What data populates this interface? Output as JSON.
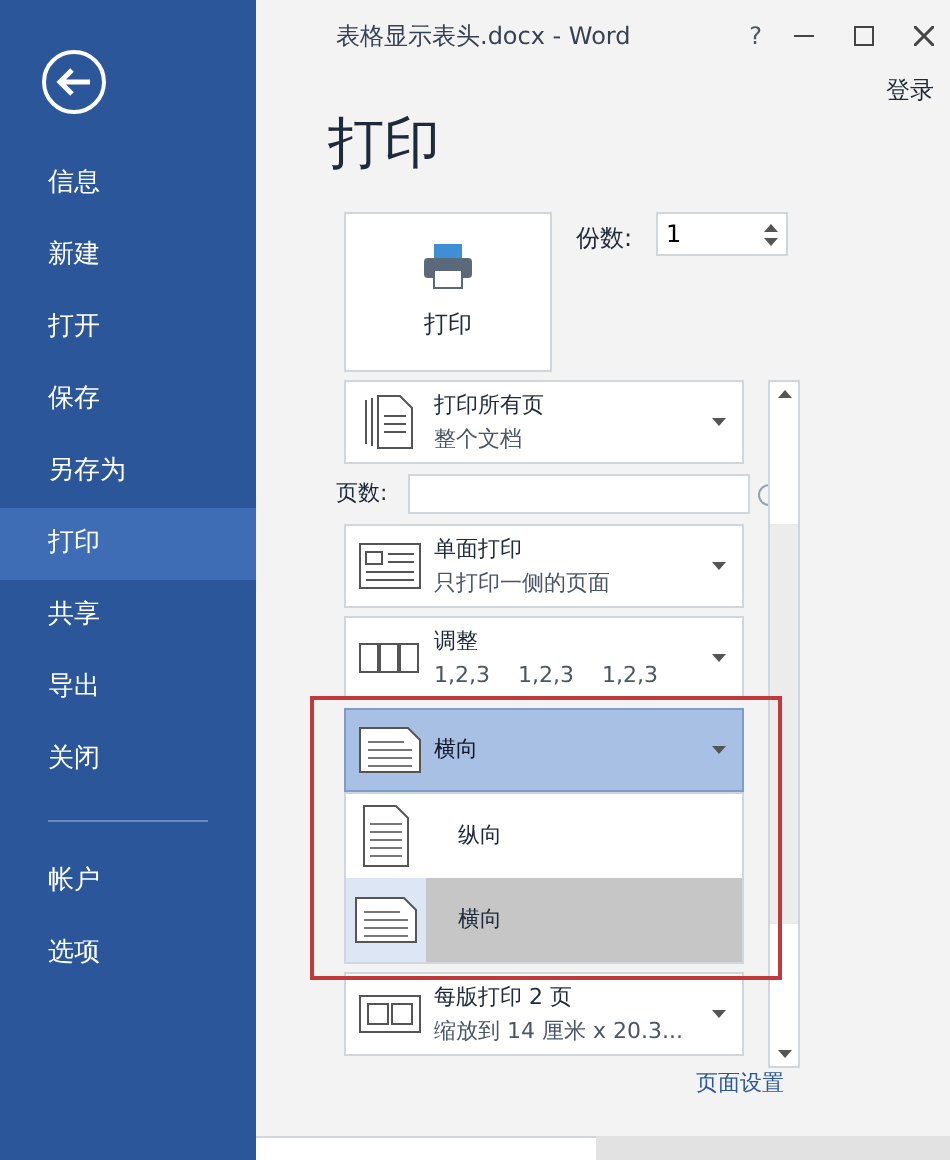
{
  "sidebar": {
    "items": [
      {
        "label": "信息",
        "selected": false
      },
      {
        "label": "新建",
        "selected": false
      },
      {
        "label": "打开",
        "selected": false
      },
      {
        "label": "保存",
        "selected": false
      },
      {
        "label": "另存为",
        "selected": false
      },
      {
        "label": "打印",
        "selected": true
      },
      {
        "label": "共享",
        "selected": false
      },
      {
        "label": "导出",
        "selected": false
      },
      {
        "label": "关闭",
        "selected": false
      }
    ],
    "footer_items": [
      {
        "label": "帐户",
        "selected": false
      },
      {
        "label": "选项",
        "selected": false
      }
    ]
  },
  "window": {
    "title": "表格显示表头.docx - Word",
    "help": "?",
    "sign_in": "登录"
  },
  "heading": "打印",
  "print_button": "打印",
  "copies": {
    "label": "份数:",
    "value": "1"
  },
  "settings": [
    {
      "kind": "dropdown",
      "title": "打印所有页",
      "subtitle": "整个文档"
    },
    {
      "kind": "field",
      "label": "页数:"
    },
    {
      "kind": "dropdown",
      "title": "单面打印",
      "subtitle": "只打印一侧的页面"
    },
    {
      "kind": "dropdown",
      "title": "调整",
      "subtitle": "1,2,3    1,2,3    1,2,3"
    },
    {
      "kind": "open",
      "title": "横向",
      "options": [
        {
          "label": "纵向",
          "selected": false
        },
        {
          "label": "横向",
          "selected": true
        }
      ]
    },
    {
      "kind": "dropdown",
      "title": "每版打印 2 页",
      "subtitle": "缩放到 14 厘米 x 20.3..."
    }
  ],
  "page_setup_link": "页面设置"
}
